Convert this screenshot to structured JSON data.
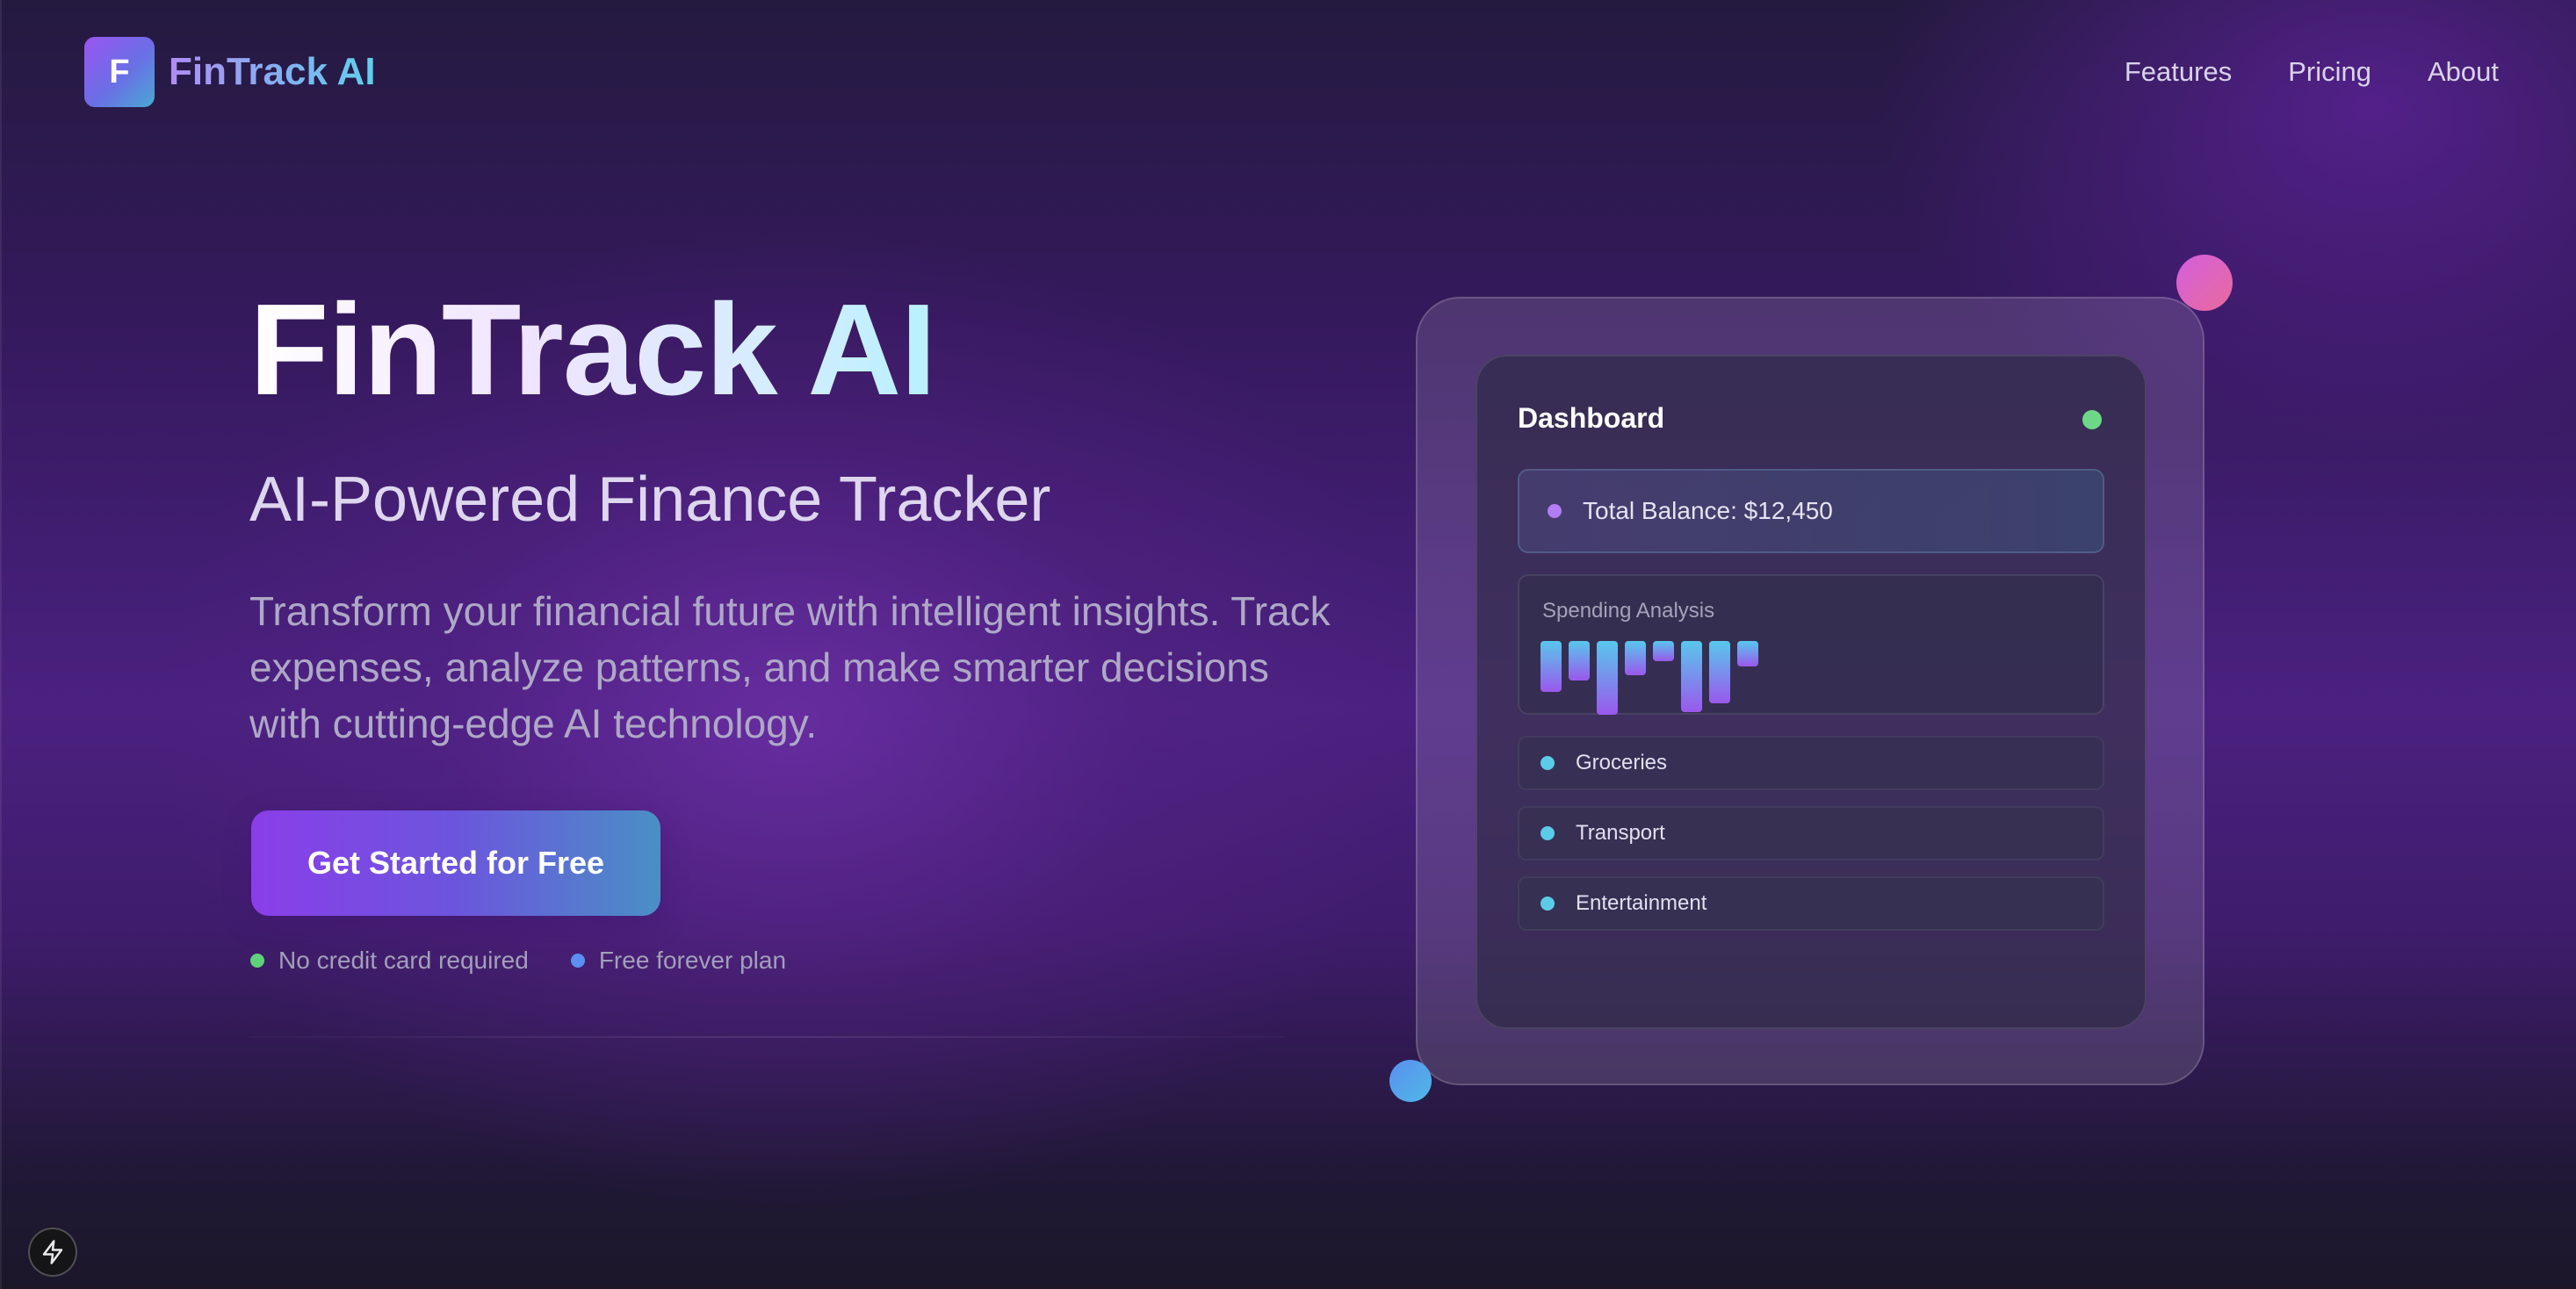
{
  "header": {
    "logo_letter": "F",
    "logo_text": "FinTrack AI",
    "nav": [
      {
        "label": "Features"
      },
      {
        "label": "Pricing"
      },
      {
        "label": "About"
      }
    ]
  },
  "hero": {
    "title": "FinTrack AI",
    "subtitle": "AI-Powered Finance Tracker",
    "description": "Transform your financial future with intelligent insights. Track expenses, analyze patterns, and make smarter decisions with cutting-edge AI technology.",
    "cta_label": "Get Started for Free",
    "perks": [
      {
        "label": "No credit card required",
        "color": "#5fd17a"
      },
      {
        "label": "Free forever plan",
        "color": "#5b8ff0"
      }
    ]
  },
  "dashboard": {
    "title": "Dashboard",
    "status_color": "#6ed787",
    "balance_text": "Total Balance: $12,450",
    "spending_label": "Spending Analysis",
    "spending_levels": [
      0.69,
      0.54,
      1.0,
      0.46,
      0.27,
      0.96,
      0.85,
      0.35
    ],
    "categories": [
      {
        "label": "Groceries"
      },
      {
        "label": "Transport"
      },
      {
        "label": "Entertainment"
      }
    ]
  },
  "icons": {
    "corner_button": "lightning-icon"
  },
  "colors": {
    "accent_purple": "#8a3ee9",
    "accent_teal": "#4a8fc6",
    "background": "#3a1a66"
  }
}
